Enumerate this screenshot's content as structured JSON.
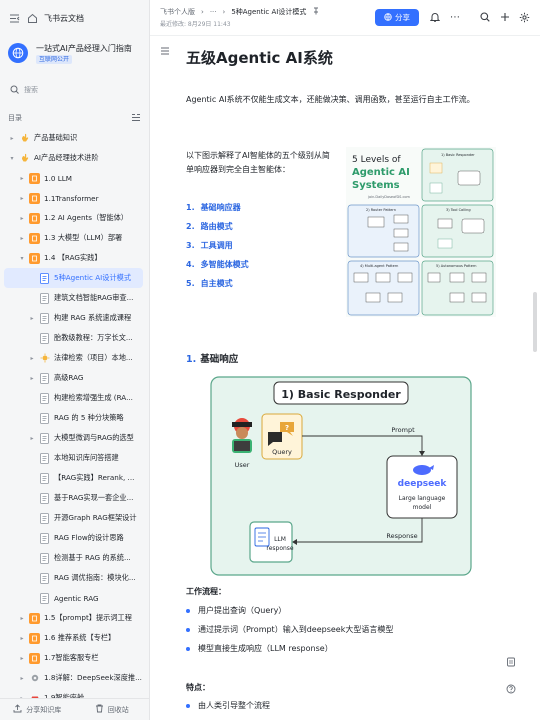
{
  "app": {
    "name": "飞书云文档"
  },
  "space": {
    "title": "一站式AI产品经理入门指南",
    "badge": "互联网公开"
  },
  "search": {
    "placeholder": "搜索"
  },
  "toc": {
    "label": "目录"
  },
  "tree": [
    {
      "label": "产品基础知识",
      "level": 0,
      "arrow": "▸",
      "icon": "hand-icon"
    },
    {
      "label": "AI产品经理技术进阶",
      "level": 0,
      "arrow": "▾",
      "icon": "hand-icon"
    },
    {
      "label": "1.0 LLM",
      "level": 1,
      "arrow": "▸",
      "icon": "orange-doc-icon"
    },
    {
      "label": "1.1Transformer",
      "level": 1,
      "arrow": "▸",
      "icon": "orange-doc-icon"
    },
    {
      "label": "1.2 AI Agents（智能体）",
      "level": 1,
      "arrow": "▸",
      "icon": "orange-doc-icon"
    },
    {
      "label": "1.3 大模型（LLM）部署",
      "level": 1,
      "arrow": "▸",
      "icon": "orange-doc-icon"
    },
    {
      "label": "1.4 【RAG实践】",
      "level": 1,
      "arrow": "▾",
      "icon": "orange-doc-icon"
    },
    {
      "label": "5种Agentic AI设计模式",
      "level": 2,
      "arrow": "",
      "icon": "doc-icon",
      "active": true
    },
    {
      "label": "建筑文档智能RAG审查...",
      "level": 2,
      "arrow": "",
      "icon": "doc-icon"
    },
    {
      "label": "构建 RAG 系统速成课程",
      "level": 2,
      "arrow": "▸",
      "icon": "doc-icon"
    },
    {
      "label": "胎教级教程：万字长文...",
      "level": 2,
      "arrow": "",
      "icon": "doc-icon"
    },
    {
      "label": "法律检索（项目）本地...",
      "level": 2,
      "arrow": "▸",
      "icon": "sun-icon"
    },
    {
      "label": "高级RAG",
      "level": 2,
      "arrow": "▸",
      "icon": "doc-icon"
    },
    {
      "label": "构建检索增强生成 (RA...",
      "level": 2,
      "arrow": "",
      "icon": "doc-icon"
    },
    {
      "label": "RAG 的 5 种分块策略",
      "level": 2,
      "arrow": "",
      "icon": "doc-icon"
    },
    {
      "label": "大模型微调与RAG的选型",
      "level": 2,
      "arrow": "▸",
      "icon": "doc-icon"
    },
    {
      "label": "本地知识库问答搭建",
      "level": 2,
      "arrow": "",
      "icon": "doc-icon"
    },
    {
      "label": "【RAG实践】Rerank, ...",
      "level": 2,
      "arrow": "",
      "icon": "doc-icon"
    },
    {
      "label": "基于RAG实现一套企业...",
      "level": 2,
      "arrow": "",
      "icon": "doc-icon"
    },
    {
      "label": "开源Graph RAG框架设计",
      "level": 2,
      "arrow": "",
      "icon": "doc-icon"
    },
    {
      "label": "RAG Flow的设计思路",
      "level": 2,
      "arrow": "",
      "icon": "doc-icon"
    },
    {
      "label": "检测基于 RAG 的系统...",
      "level": 2,
      "arrow": "",
      "icon": "doc-icon"
    },
    {
      "label": "RAG 调优指南：模块化...",
      "level": 2,
      "arrow": "",
      "icon": "doc-icon"
    },
    {
      "label": "Agentic RAG",
      "level": 2,
      "arrow": "",
      "icon": "doc-icon"
    },
    {
      "label": "1.5【prompt】提示词工程",
      "level": 1,
      "arrow": "▸",
      "icon": "orange-doc-icon"
    },
    {
      "label": "1.6 推荐系统【专栏】",
      "level": 1,
      "arrow": "▸",
      "icon": "orange-doc-icon"
    },
    {
      "label": "1.7智能客服专栏",
      "level": 1,
      "arrow": "▸",
      "icon": "orange-doc-icon"
    },
    {
      "label": "1.8详解：DeepSeek深度推...",
      "level": 1,
      "arrow": "▸",
      "icon": "gear-icon"
    },
    {
      "label": "1.9智能座舱",
      "level": 1,
      "arrow": "▸",
      "icon": "car-icon"
    }
  ],
  "sidebar_bottom": {
    "share_library": "分享知识库",
    "recycle": "回收站"
  },
  "header": {
    "breadcrumb_root": "飞书个人版",
    "breadcrumb_more": "···",
    "breadcrumb_current": "5种Agentic AI设计模式",
    "last_edit": "最近修改: 8月29日 11:43",
    "share_label": "分享"
  },
  "doc": {
    "title": "五级Agentic AI系统",
    "intro": "Agentic AI系统不仅能生成文本，还能做决策、调用函数，甚至运行自主工作流。",
    "explain": "以下图示解释了AI智能体的五个级别从简单响应器到完全自主智能体：",
    "levels": [
      {
        "num": "1.",
        "label": "基础响应器"
      },
      {
        "num": "2.",
        "label": "路由模式"
      },
      {
        "num": "3.",
        "label": "工具调用"
      },
      {
        "num": "4.",
        "label": "多智能体模式"
      },
      {
        "num": "5.",
        "label": "自主模式"
      }
    ],
    "section1": {
      "num": "1.",
      "title": "基础响应"
    },
    "workflow_label": "工作流程",
    "workflow_colon": "：",
    "workflow": [
      "用户提出查询（Query）",
      "通过提示词（Prompt）输入到deepseek大型语言模型",
      "模型直接生成响应（LLM response）"
    ],
    "features_label": "特点",
    "features_colon": "：",
    "features": [
      "由人类引导整个流程"
    ]
  },
  "thumbnail": {
    "title_line1": "5 Levels of",
    "title_line2": "Agentic AI",
    "title_line3": "Systems",
    "url": "join.DailyDoseofDS.com",
    "panels": [
      "1) Basic Responder",
      "2) Router Pattern",
      "3) Tool Calling",
      "4) Multi-agent Pattern",
      "5) Autonomous Pattern"
    ]
  },
  "diagram": {
    "title": "1) Basic Responder",
    "user": "User",
    "query": "Query",
    "prompt": "Prompt",
    "brand": "deepseek",
    "llm_line1": "Large language",
    "llm_line2": "model",
    "response": "Response",
    "out_line1": "LLM",
    "out_line2": "response"
  },
  "colors": {
    "accent": "#3370ff",
    "diagram_bg": "#e6f4ee",
    "diagram_border": "#5aa68a"
  }
}
